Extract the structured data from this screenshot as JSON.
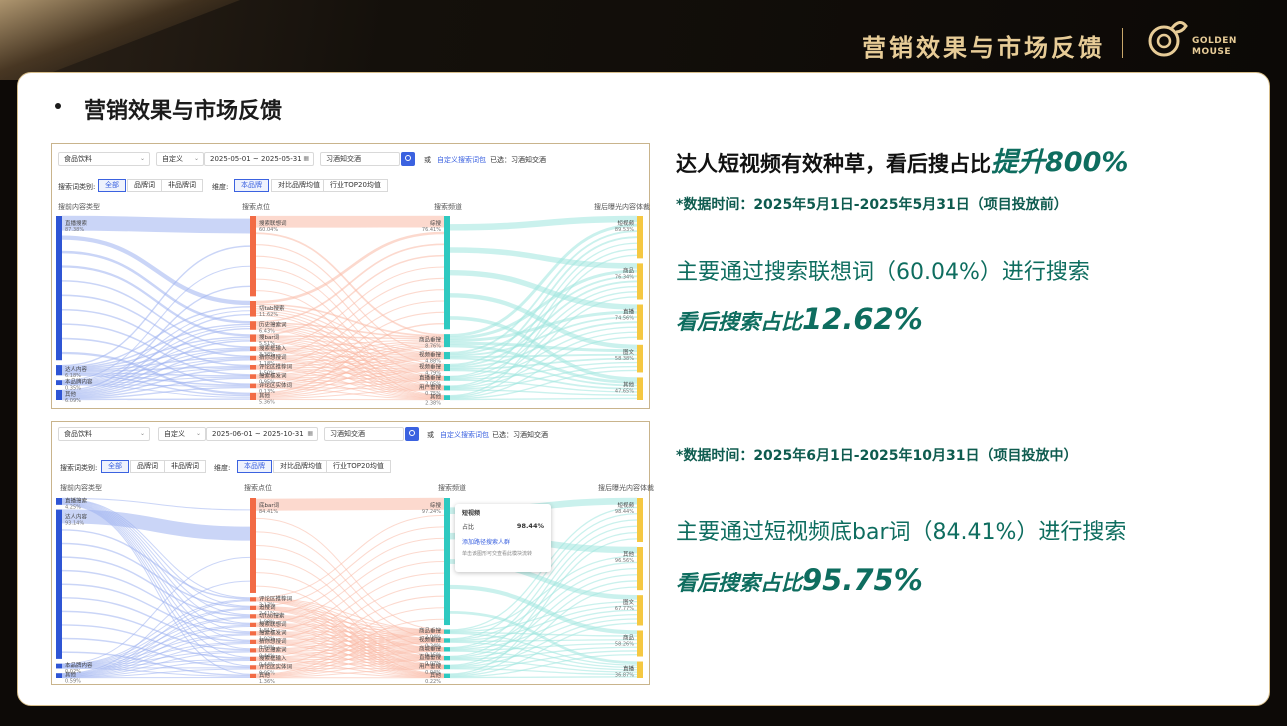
{
  "header": {
    "title": "营销效果与市场反馈",
    "logo_text_line1": "GOLDEN",
    "logo_text_line2": "MOUSE"
  },
  "section": {
    "title": "营销效果与市场反馈"
  },
  "screenshot1": {
    "category": "食品饮料",
    "mode": "自定义",
    "date_range": "2025-05-01 ~ 2025-05-31",
    "keyword": "习酒知交酒",
    "or_text": "或",
    "custom_link": "自定义搜索词包",
    "selected_text": "已选：习酒知交酒",
    "word_type_label": "搜索词类别:",
    "word_types": [
      "全部",
      "品牌词",
      "非品牌词"
    ],
    "dimension_label": "维度:",
    "dimensions": [
      "本品牌",
      "对比品牌均值",
      "行业TOP20均值"
    ],
    "columns": [
      "搜前内容类型",
      "搜索点位",
      "搜索频道",
      "搜后曝光内容体裁"
    ],
    "col1": [
      {
        "name": "直播搜索",
        "pct": "87.38%"
      },
      {
        "name": "达人内容",
        "pct": "6.18%"
      },
      {
        "name": "本品牌内容",
        "pct": "0.35%"
      },
      {
        "name": "其他",
        "pct": "6.09%"
      }
    ],
    "col2": [
      {
        "name": "搜索联想词",
        "pct": "60.04%"
      },
      {
        "name": "切tab搜索",
        "pct": "11.62%"
      },
      {
        "name": "历史搜索词",
        "pct": "6.43%"
      },
      {
        "name": "搜bar词",
        "pct": "5.51%"
      },
      {
        "name": "搜索框输入",
        "pct": "3.38%"
      },
      {
        "name": "猜你想搜词",
        "pct": "1.18%"
      },
      {
        "name": "评论区推荐词",
        "pct": "1.50%"
      },
      {
        "name": "搜索框发词",
        "pct": "0.95%"
      },
      {
        "name": "评论区实体词",
        "pct": "0.13%"
      },
      {
        "name": "其他",
        "pct": "5.36%"
      }
    ],
    "col3": [
      {
        "name": "综搜",
        "pct": "76.41%"
      },
      {
        "name": "商品垂搜",
        "pct": "8.76%"
      },
      {
        "name": "视频垂搜",
        "pct": "4.88%"
      },
      {
        "name": "视频垂搜",
        "pct": "4.79%"
      },
      {
        "name": "直播垂搜",
        "pct": "2.05%"
      },
      {
        "name": "用户垂搜",
        "pct": "0.75%"
      },
      {
        "name": "其他",
        "pct": "2.38%"
      }
    ],
    "col4": [
      {
        "name": "短视频",
        "pct": "89.53%"
      },
      {
        "name": "商品",
        "pct": "76.34%"
      },
      {
        "name": "直播",
        "pct": "74.56%"
      },
      {
        "name": "图文",
        "pct": "58.38%"
      },
      {
        "name": "其他",
        "pct": "47.65%"
      }
    ]
  },
  "screenshot2": {
    "category": "食品饮料",
    "mode": "自定义",
    "date_range": "2025-06-01 ~ 2025-10-31",
    "keyword": "习酒知交酒",
    "or_text": "或",
    "custom_link": "自定义搜索词包",
    "selected_text": "已选：习酒知交酒",
    "word_type_label": "搜索词类别:",
    "word_types": [
      "全部",
      "品牌词",
      "非品牌词"
    ],
    "dimension_label": "维度:",
    "dimensions": [
      "本品牌",
      "对比品牌均值",
      "行业TOP20均值"
    ],
    "columns": [
      "搜前内容类型",
      "搜索点位",
      "搜索频道",
      "搜后曝光内容体裁"
    ],
    "col1": [
      {
        "name": "直播搜索",
        "pct": "4.25%"
      },
      {
        "name": "达人内容",
        "pct": "93.14%"
      },
      {
        "name": "本品牌内容",
        "pct": "0.02%"
      },
      {
        "name": "其他",
        "pct": "0.59%"
      }
    ],
    "col2": [
      {
        "name": "底bar词",
        "pct": "84.41%"
      },
      {
        "name": "评论区推荐词",
        "pct": "3.17%"
      },
      {
        "name": "追搜词",
        "pct": "2.41%"
      },
      {
        "name": "切tab搜索",
        "pct": "1.98%"
      },
      {
        "name": "搜索联想词",
        "pct": "1.81%"
      },
      {
        "name": "搜索框发词",
        "pct": "1.02%"
      },
      {
        "name": "猜你想搜词",
        "pct": "0.84%"
      },
      {
        "name": "历史搜索词",
        "pct": "0.44%"
      },
      {
        "name": "搜索框输入",
        "pct": "0.44%"
      },
      {
        "name": "评论区实体词",
        "pct": "0.05%"
      },
      {
        "name": "其他",
        "pct": "1.36%"
      }
    ],
    "col3": [
      {
        "name": "综搜",
        "pct": "97.24%"
      },
      {
        "name": "商品垂搜",
        "pct": "2.04%"
      },
      {
        "name": "视频垂搜",
        "pct": "0.24%"
      },
      {
        "name": "商城垂搜",
        "pct": "0.15%"
      },
      {
        "name": "直播垂搜",
        "pct": "0.07%"
      },
      {
        "name": "用户垂搜",
        "pct": "0.04%"
      },
      {
        "name": "其他",
        "pct": "0.22%"
      }
    ],
    "col4": [
      {
        "name": "短视频",
        "pct": "98.44%"
      },
      {
        "name": "其他",
        "pct": "96.56%"
      },
      {
        "name": "图文",
        "pct": "67.77%"
      },
      {
        "name": "商品",
        "pct": "58.26%"
      },
      {
        "name": "直播",
        "pct": "36.87%"
      }
    ],
    "tooltip": {
      "title": "短视频",
      "row_label": "占比",
      "row_value": "98.44%",
      "link": "添加路径搜索人群",
      "sub": "单击该图形可交查看此模块流转"
    }
  },
  "right": {
    "headline_prefix": "达人短视频有效种草，看后搜占比",
    "headline_highlight": "提升800%",
    "date1": "*数据时间：2025年5月1日-2025年5月31日（项目投放前）",
    "main1": "主要通过搜索联想词（60.04%）进行搜索",
    "share1_label": "看后搜索占比",
    "share1_value": "12.62%",
    "date2": "*数据时间：2025年6月1日-2025年10月31日（项目投放中）",
    "main2": "主要通过短视频底bar词（84.41%）进行搜索",
    "share2_label": "看后搜索占比",
    "share2_value": "95.75%"
  },
  "colors": {
    "gold": "#e7cc97",
    "teal": "#0e6d5f",
    "col1_node": "#2f55d4",
    "col2_node": "#f26b45",
    "col3_node": "#2ec9c0",
    "col4_node": "#f5c842",
    "link_blue": "#3b62e0"
  }
}
